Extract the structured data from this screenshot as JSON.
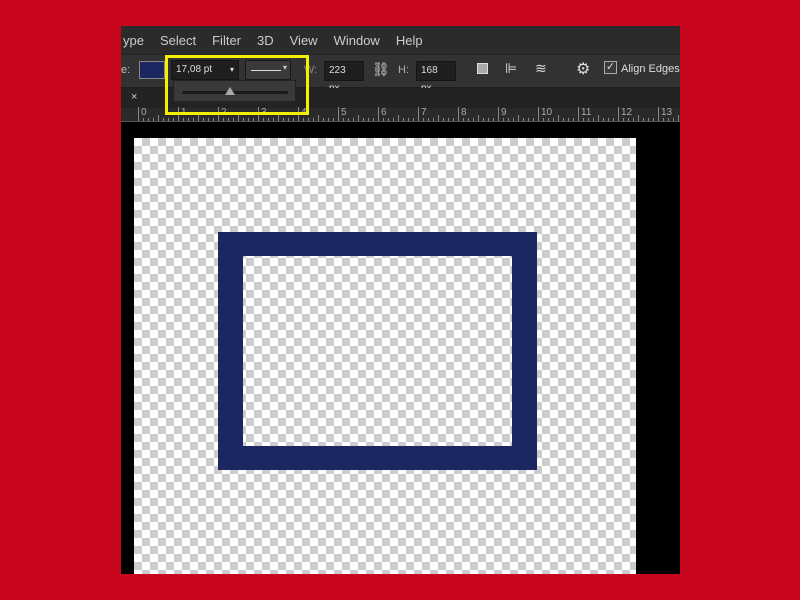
{
  "menu": [
    "ype",
    "Select",
    "Filter",
    "3D",
    "View",
    "Window",
    "Help"
  ],
  "options": {
    "fill_label": "e:",
    "fill_color": "#1c2660",
    "stroke_width": "17,08 pt",
    "stroke_slider_percent": 45,
    "w_label": "W:",
    "width": "223 px",
    "h_label": "H:",
    "height": "168 px",
    "align_edges_label": "Align Edges",
    "align_edges_checked": true
  },
  "tab": {
    "close": "×"
  },
  "ruler": [
    "0",
    "1",
    "2",
    "3",
    "4",
    "5",
    "6",
    "7",
    "8",
    "9",
    "10",
    "11",
    "12",
    "13"
  ],
  "colors": {
    "background": "#c8071e",
    "highlight": "#f5f000",
    "shape_stroke": "#1c2660"
  }
}
